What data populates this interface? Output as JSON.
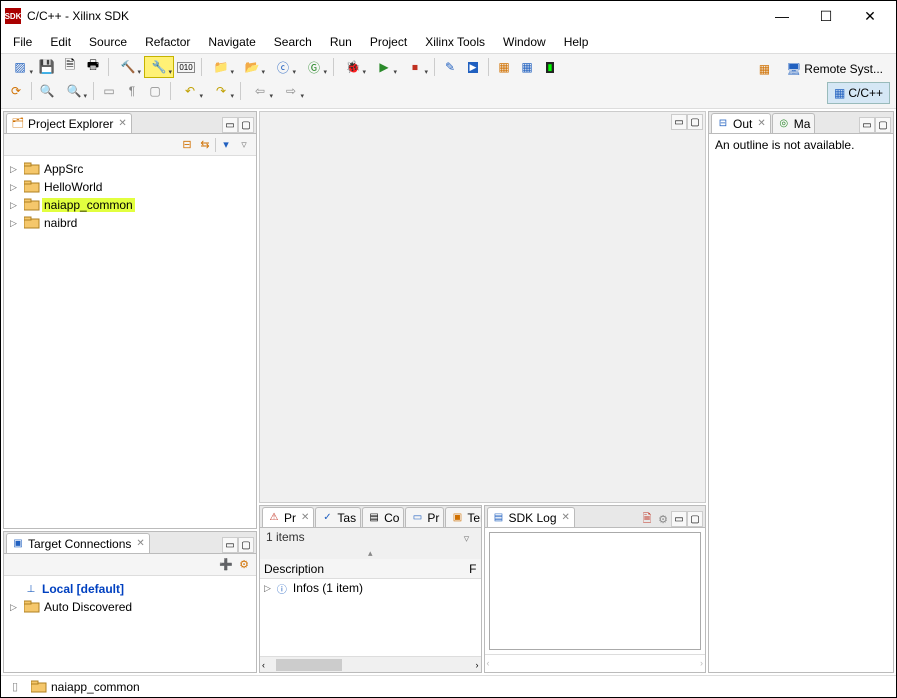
{
  "title": "C/C++ - Xilinx SDK",
  "app_icon_text": "SDK",
  "menu": [
    "File",
    "Edit",
    "Source",
    "Refactor",
    "Navigate",
    "Search",
    "Run",
    "Project",
    "Xilinx Tools",
    "Window",
    "Help"
  ],
  "perspectives": {
    "remote": "Remote Syst...",
    "cpp": "C/C++"
  },
  "project_explorer": {
    "title": "Project Explorer",
    "items": [
      {
        "label": "AppSrc",
        "selected": false
      },
      {
        "label": "HelloWorld",
        "selected": false
      },
      {
        "label": "naiapp_common",
        "selected": true
      },
      {
        "label": "naibrd",
        "selected": false
      }
    ]
  },
  "target_connections": {
    "title": "Target Connections",
    "items": [
      {
        "label": "Local [default]",
        "bold": true,
        "icon": "node"
      },
      {
        "label": "Auto Discovered",
        "bold": false,
        "icon": "folder"
      }
    ]
  },
  "outline": {
    "tab1": "Out",
    "tab2": "Ma",
    "message": "An outline is not available."
  },
  "problems": {
    "tabs": [
      "Pr",
      "Tas",
      "Co",
      "Pr",
      "Ter"
    ],
    "count_text": "1 items",
    "header_col": "Description",
    "row_label": "Infos (1 item)"
  },
  "sdklog": {
    "title": "SDK Log"
  },
  "status": {
    "project": "naiapp_common"
  }
}
